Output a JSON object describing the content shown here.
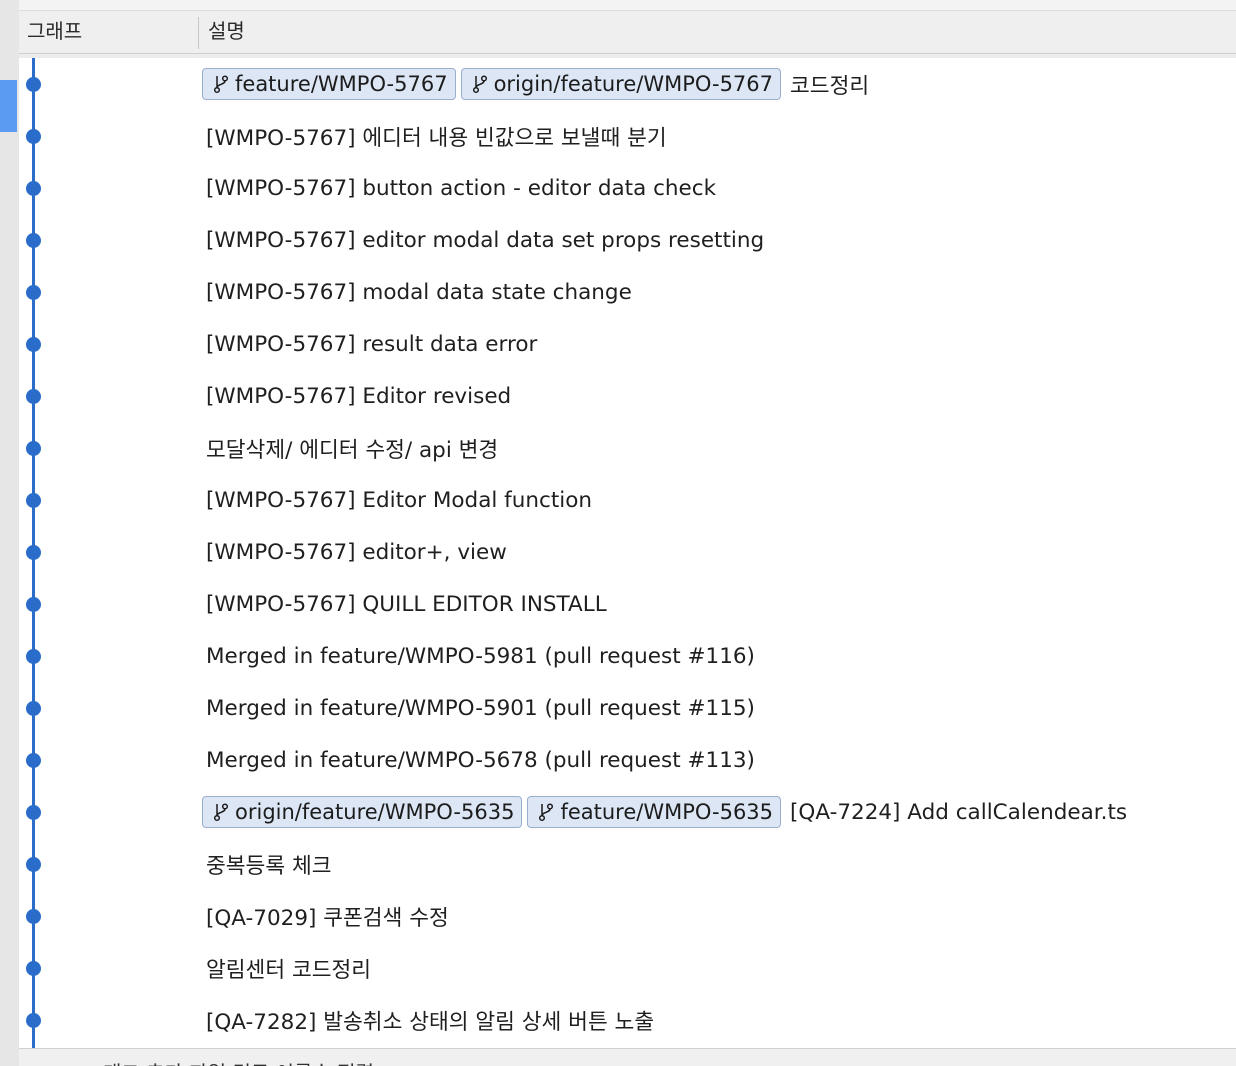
{
  "header": {
    "graph_label": "그래프",
    "description_label": "설명"
  },
  "colors": {
    "graph_line": "#2a6cc9",
    "tag_background": "#dce6f5",
    "tag_border": "#9aafcc",
    "selection_marker": "#5b9cf2"
  },
  "commits": [
    {
      "tags": [
        "feature/WMPO-5767",
        "origin/feature/WMPO-5767"
      ],
      "message": "코드정리"
    },
    {
      "tags": [],
      "message": "[WMPO-5767] 에디터 내용 빈값으로 보낼때 분기"
    },
    {
      "tags": [],
      "message": "[WMPO-5767] button action - editor data check"
    },
    {
      "tags": [],
      "message": "[WMPO-5767] editor modal data set props resetting"
    },
    {
      "tags": [],
      "message": "[WMPO-5767] modal data state change"
    },
    {
      "tags": [],
      "message": "[WMPO-5767] result data error"
    },
    {
      "tags": [],
      "message": "[WMPO-5767] Editor revised"
    },
    {
      "tags": [],
      "message": "모달삭제/ 에디터 수정/ api 변경"
    },
    {
      "tags": [],
      "message": "[WMPO-5767] Editor Modal function"
    },
    {
      "tags": [],
      "message": "[WMPO-5767] editor+, view"
    },
    {
      "tags": [],
      "message": "[WMPO-5767] QUILL EDITOR INSTALL"
    },
    {
      "tags": [],
      "message": "Merged in feature/WMPO-5981 (pull request #116)"
    },
    {
      "tags": [],
      "message": "Merged in feature/WMPO-5901 (pull request #115)"
    },
    {
      "tags": [],
      "message": "Merged in feature/WMPO-5678 (pull request #113)"
    },
    {
      "tags": [
        "origin/feature/WMPO-5635",
        "feature/WMPO-5635"
      ],
      "message": "[QA-7224] Add callCalendear.ts"
    },
    {
      "tags": [],
      "message": "중복등록 체크"
    },
    {
      "tags": [],
      "message": "[QA-7029] 쿠폰검색 수정"
    },
    {
      "tags": [],
      "message": "알림센터 코드정리"
    },
    {
      "tags": [],
      "message": "[QA-7282] 발송취소 상태의 알림 상세 버튼 노출"
    }
  ],
  "footer": {
    "text": "태그 추가 파일 경로 이름순 정렬"
  }
}
